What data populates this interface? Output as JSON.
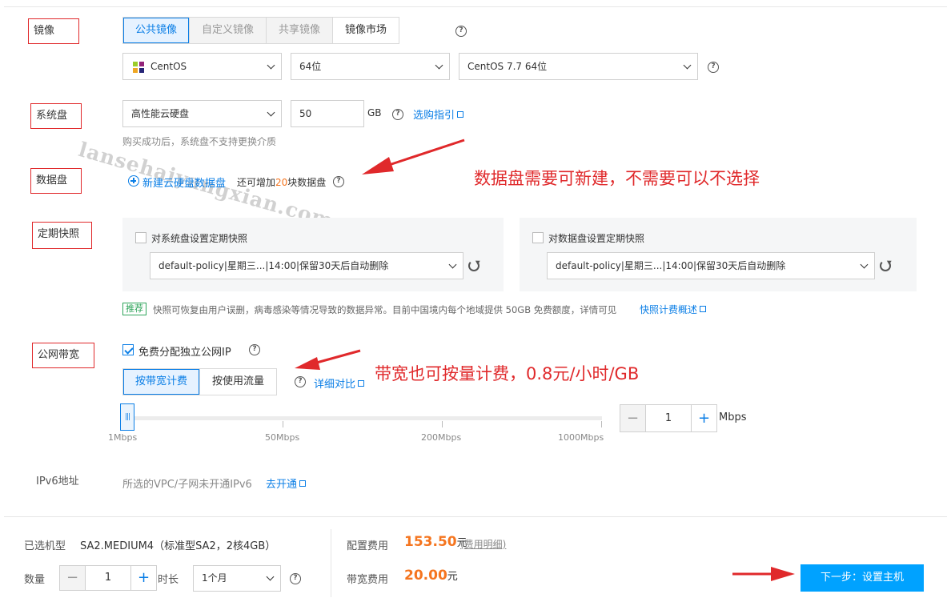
{
  "image": {
    "label": "镜像",
    "tabs": [
      "公共镜像",
      "自定义镜像",
      "共享镜像",
      "镜像市场"
    ],
    "os_select": "CentOS",
    "bit_select": "64位",
    "version_select": "CentOS 7.7 64位"
  },
  "system_disk": {
    "label": "系统盘",
    "type_select": "高性能云硬盘",
    "size_value": "50",
    "unit": "GB",
    "guide_link": "选购指引",
    "note": "购买成功后，系统盘不支持更换介质"
  },
  "data_disk": {
    "label": "数据盘",
    "add_link": "新建云硬盘数据盘",
    "note_prefix": "还可增加",
    "note_count": "20",
    "note_suffix": "块数据盘"
  },
  "snapshot": {
    "label": "定期快照",
    "system_checkbox": "对系统盘设置定期快照",
    "system_policy": "default-policy|星期三...|14:00|保留30天后自动删除",
    "data_checkbox": "对数据盘设置定期快照",
    "data_policy": "default-policy|星期三...|14:00|保留30天后自动删除",
    "tag": "推荐",
    "note": "快照可恢复由用户误删，病毒感染等情况导致的数据异常。目前中国境内每个地域提供 50GB 免费额度，详情可见",
    "note_link": "快照计费概述"
  },
  "bandwidth": {
    "label": "公网带宽",
    "free_ip_checkbox": "免费分配独立公网IP",
    "tabs": [
      "按带宽计费",
      "按使用流量"
    ],
    "compare_link": "详细对比",
    "slider_ticks": [
      "1Mbps",
      "50Mbps",
      "200Mbps",
      "1000Mbps"
    ],
    "slider_level": 0,
    "stepper_value": "1",
    "stepper_minus": "−",
    "stepper_plus": "+",
    "unit": "Mbps"
  },
  "ipv6": {
    "label": "IPv6地址",
    "note": "所选的VPC/子网未开通IPv6",
    "link": "去开通"
  },
  "annotations": {
    "data_disk": "数据盘需要可新建，不需要可以不选择",
    "bandwidth": "带宽也可按量计费，0.8元/小时/GB"
  },
  "watermark": "lansehaiyangxian.com",
  "footer": {
    "model_label": "已选机型",
    "model_value": "SA2.MEDIUM4（标准型SA2，2核4GB）",
    "qty_label": "数量",
    "qty_value": "1",
    "qty_minus": "−",
    "qty_plus": "+",
    "duration_label": "时长",
    "duration_value": "1个月",
    "config_fee_label": "配置费用",
    "config_fee_value": "153.50",
    "config_fee_unit": "元",
    "fee_detail_link": "(费用明细)",
    "bandwidth_fee_label": "带宽费用",
    "bandwidth_fee_value": "20.00",
    "bandwidth_fee_unit": "元",
    "next_button": "下一步：设置主机"
  },
  "colors": {
    "accent": "#0a7ee6",
    "annotation_red": "#e0292b",
    "price_orange": "#f5751f",
    "primary_button": "#00a2ff"
  }
}
